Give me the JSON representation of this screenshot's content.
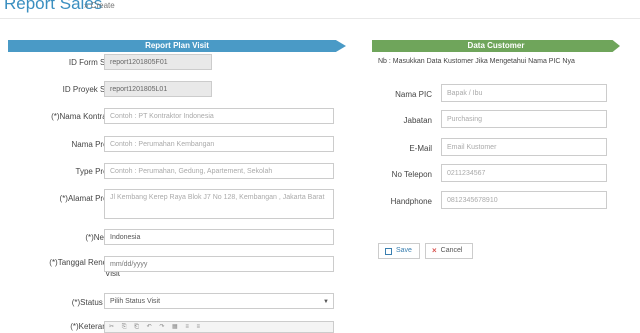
{
  "header": {
    "title": "Report Sales",
    "subtitle": "» Create"
  },
  "left_panel": {
    "title": "Report Plan Visit",
    "fields": {
      "id_form": {
        "label": "ID Form Sales",
        "value": "report1201805F01"
      },
      "id_proyek": {
        "label": "ID Proyek Sales",
        "value": "report1201805L01"
      },
      "kontraktor": {
        "label": "(*)Nama Kontraktor",
        "placeholder": "Contoh : PT Kontraktor Indonesia"
      },
      "nama_proyek": {
        "label": "Nama Proyek",
        "placeholder": "Contoh : Perumahan Kembangan"
      },
      "type_proyek": {
        "label": "Type Proyek",
        "placeholder": "Contoh : Perumahan, Gedung, Apartement, Sekolah"
      },
      "alamat": {
        "label": "(*)Alamat Proyek",
        "placeholder": "Jl Kembang Kerep Raya Blok J7 No 128, Kembangan , Jakarta Barat"
      },
      "negara": {
        "label": "(*)Negara",
        "value": "Indonesia"
      },
      "tanggal": {
        "label_line1": "(*)Tanggal Rencana",
        "label_line2": "Visit",
        "placeholder": "mm/dd/yyyy"
      },
      "status": {
        "label": "(*)Status Visit",
        "value": "Pilih Status Visit"
      },
      "keterangan": {
        "label": "(*)Keterangan"
      }
    }
  },
  "right_panel": {
    "title": "Data Customer",
    "note": "Nb : Masukkan Data Kustomer Jika Mengetahui Nama PIC Nya",
    "fields": {
      "nama_pic": {
        "label": "Nama PIC",
        "placeholder": "Bapak / Ibu"
      },
      "jabatan": {
        "label": "Jabatan",
        "placeholder": "Purchasing"
      },
      "email": {
        "label": "E-Mail",
        "placeholder": "Email Kustomer"
      },
      "telepon": {
        "label": "No Telepon",
        "placeholder": "0211234567"
      },
      "handphone": {
        "label": "Handphone",
        "placeholder": "0812345678910"
      }
    }
  },
  "actions": {
    "save_label": "Save",
    "cancel_label": "Cancel"
  },
  "icons": {
    "save": "save-icon",
    "cancel": "close-icon",
    "dropdown": "chevron-down-icon"
  },
  "colors": {
    "title_blue": "#3a8fc0",
    "banner_blue": "#4a9ac6",
    "banner_green": "#6fa55b",
    "cancel_red": "#d9534f"
  }
}
